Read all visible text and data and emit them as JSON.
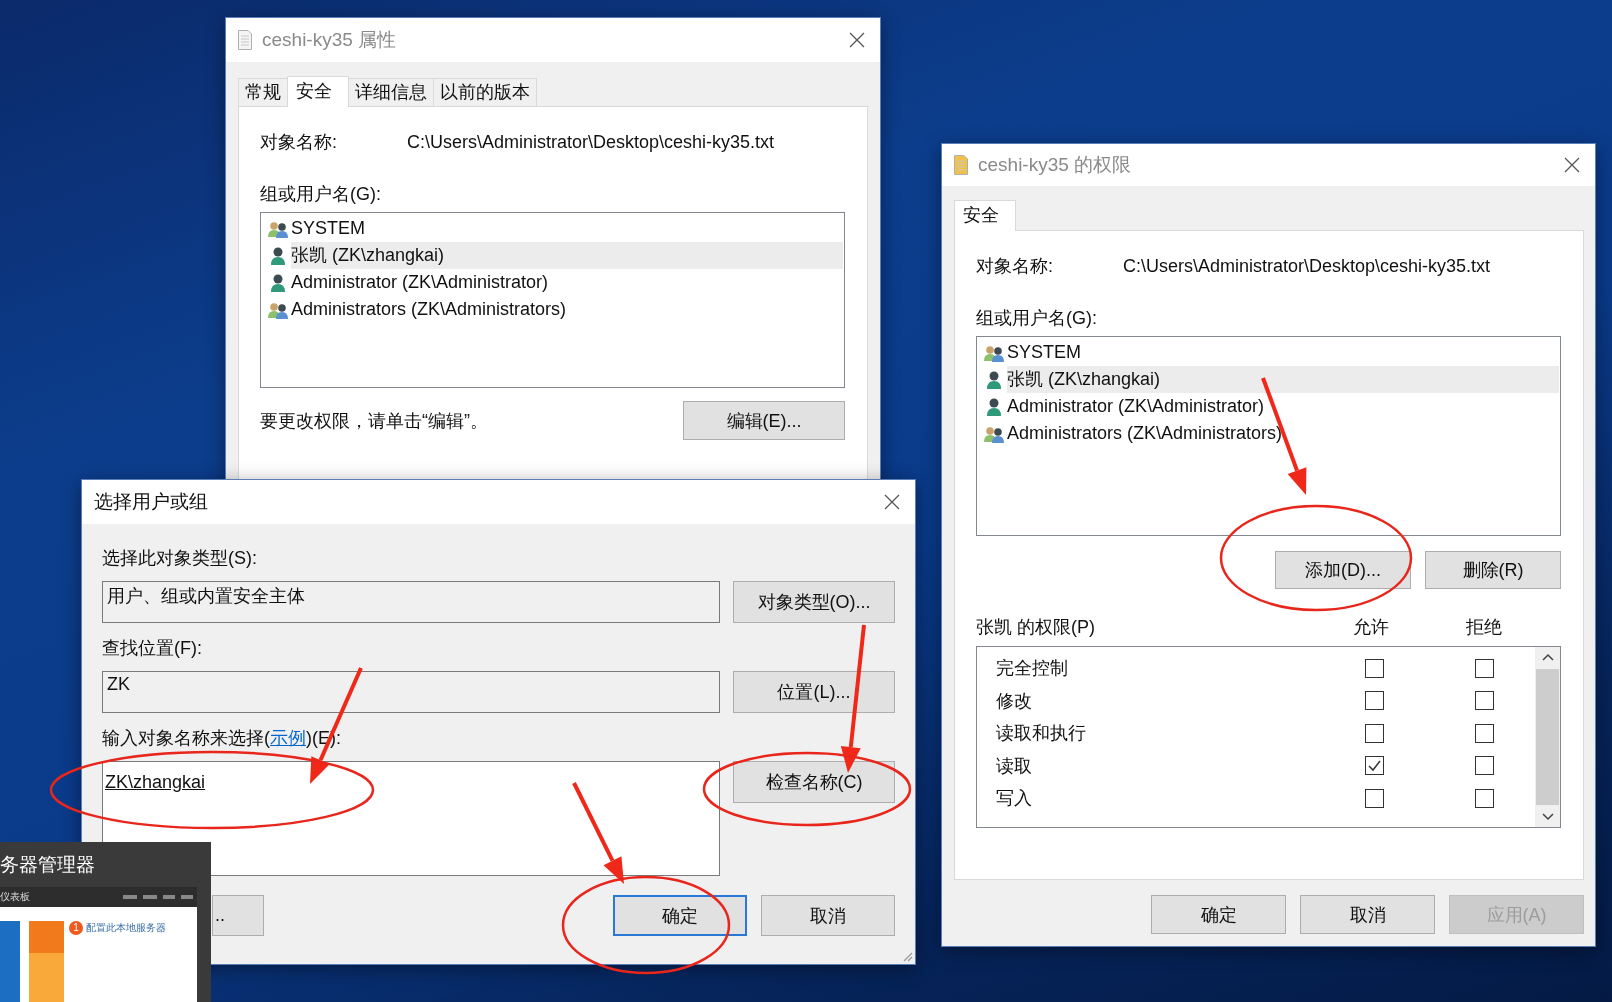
{
  "properties_dialog": {
    "title": "ceshi-ky35 属性",
    "tabs": [
      {
        "label": "常规",
        "selected": false
      },
      {
        "label": "安全",
        "selected": true
      },
      {
        "label": "详细信息",
        "selected": false
      },
      {
        "label": "以前的版本",
        "selected": false
      }
    ],
    "object_name_label": "对象名称:",
    "object_name": "C:\\Users\\Administrator\\Desktop\\ceshi-ky35.txt",
    "group_label": "组或用户名(G):",
    "groups": [
      {
        "name": "SYSTEM",
        "kind": "group",
        "selected": false
      },
      {
        "name": "张凯 (ZK\\zhangkai)",
        "kind": "user",
        "selected": true
      },
      {
        "name": "Administrator (ZK\\Administrator)",
        "kind": "user",
        "selected": false
      },
      {
        "name": "Administrators (ZK\\Administrators)",
        "kind": "group",
        "selected": false
      }
    ],
    "hint": "要更改权限，请单击“编辑”。",
    "edit_button": "编辑(E)..."
  },
  "select_dialog": {
    "title": "选择用户或组",
    "object_type_label": "选择此对象类型(S):",
    "object_type": "用户、组或内置安全主体",
    "object_type_button": "对象类型(O)...",
    "location_label": "查找位置(F):",
    "location": "ZK",
    "location_button": "位置(L)...",
    "names_label_before": "输入对象名称来选择(",
    "names_link": "示例",
    "names_label_after": ")(E):",
    "names_value": "ZK\\zhangkai",
    "check_button": "检查名称(C)",
    "buttons": [
      {
        "label": "..",
        "default": false
      },
      {
        "label": "确定",
        "default": true
      },
      {
        "label": "取消",
        "default": false
      }
    ]
  },
  "permissions_dialog": {
    "title": "ceshi-ky35 的权限",
    "tabs": [
      {
        "label": "安全",
        "selected": true
      }
    ],
    "object_name_label": "对象名称:",
    "object_name": "C:\\Users\\Administrator\\Desktop\\ceshi-ky35.txt",
    "group_label": "组或用户名(G):",
    "groups": [
      {
        "name": "SYSTEM",
        "kind": "group",
        "selected": false
      },
      {
        "name": "张凯 (ZK\\zhangkai)",
        "kind": "user",
        "selected": true
      },
      {
        "name": "Administrator (ZK\\Administrator)",
        "kind": "user",
        "selected": false
      },
      {
        "name": "Administrators (ZK\\Administrators)",
        "kind": "group",
        "selected": false
      }
    ],
    "add_button": "添加(D)...",
    "remove_button": "删除(R)",
    "permissions_label": "张凯 的权限(P)",
    "allow_header": "允许",
    "deny_header": "拒绝",
    "permissions": [
      {
        "name": "完全控制",
        "allow": false,
        "deny": false
      },
      {
        "name": "修改",
        "allow": false,
        "deny": false
      },
      {
        "name": "读取和执行",
        "allow": false,
        "deny": false
      },
      {
        "name": "读取",
        "allow": true,
        "deny": false
      },
      {
        "name": "写入",
        "allow": false,
        "deny": false
      }
    ],
    "buttons": [
      {
        "label": "确定",
        "disabled": false
      },
      {
        "label": "取消",
        "disabled": false
      },
      {
        "label": "应用(A)",
        "disabled": true
      }
    ]
  },
  "server_manager_thumbnail": {
    "title": "务器管理器",
    "nav": "仪表板",
    "task_number": "1",
    "task": "配置此本地服务器"
  }
}
